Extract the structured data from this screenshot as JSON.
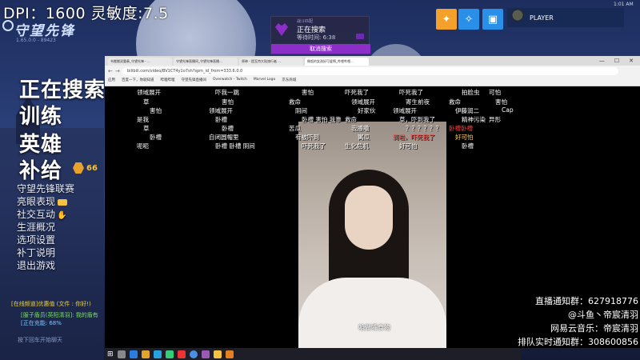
{
  "overlay": {
    "dpi_text": "DPI：1600 灵敏度:7.5",
    "clock": "1:01 AM"
  },
  "game": {
    "logo": "守望先锋",
    "version": "1.65.0.0 - 89423",
    "main_menu": [
      "正在搜索",
      "训练",
      "英雄",
      "补给"
    ],
    "level": "66",
    "sub_menu": [
      "守望先锋联赛",
      "亮眼表现",
      "社交互动",
      "生涯概况",
      "选项设置",
      "补丁说明",
      "退出游戏"
    ],
    "chat": [
      "[在线频道]优惠值 (文件 : 你好!)",
      "[服子盾员(英阳清羽]: 我的盾有",
      "[正在充能: 68%"
    ],
    "footnote": "按下回车开始聊天",
    "player_name": "PLAYER"
  },
  "search_popup": {
    "small": "战斗匹配",
    "title": "正在搜索",
    "wait": "等待时间: 6:38",
    "cancel": "取消搜索"
  },
  "browser": {
    "tabs": [
      "韦搬搬双重奏_守望先锋 - ...",
      "守望先锋直播间_守望先锋直播...",
      "原神 - 提瓦特大陆旅行者 ...",
      "做饭的女孩好可爱啊_哔哩哔哩..."
    ],
    "url": "bilibili.com/video/BV1CT4y1o7sh?spm_id_from=333.6.0.0",
    "bookmarks": [
      "应用",
      "百度一下，你就知道",
      "哔哩哔哩",
      "守望先锋直播间",
      "Overwatch - Twitch",
      "Marvel Logo",
      "京东商城"
    ]
  },
  "danmaku": [
    {
      "t": "领域展开",
      "c": "white"
    },
    {
      "t": "草",
      "c": "white"
    },
    {
      "t": "害怕",
      "c": "white"
    },
    {
      "t": "是我",
      "c": "white"
    },
    {
      "t": "草",
      "c": "white"
    },
    {
      "t": "卧槽",
      "c": "white"
    },
    {
      "t": "呃呃",
      "c": "white"
    },
    {
      "t": "吓我一跳",
      "c": "white"
    },
    {
      "t": "害怕",
      "c": "white"
    },
    {
      "t": "领域展开",
      "c": "white"
    },
    {
      "t": "卧槽",
      "c": "white"
    },
    {
      "t": "卧槽",
      "c": "white"
    },
    {
      "t": "自闭圆帽里",
      "c": "white"
    },
    {
      "t": "卧槽 卧槽 阴间",
      "c": "white"
    },
    {
      "t": "害怕",
      "c": "white"
    },
    {
      "t": "救命",
      "c": "white"
    },
    {
      "t": "阴间",
      "c": "white"
    },
    {
      "t": "卧槽 害怕 我靠",
      "c": "white"
    },
    {
      "t": "苦瓜",
      "c": "white"
    },
    {
      "t": "有被吓到",
      "c": "white"
    },
    {
      "t": "吓死我了",
      "c": "white"
    },
    {
      "t": "吓死我了",
      "c": "white"
    },
    {
      "t": "领域展开",
      "c": "white"
    },
    {
      "t": "好家伙",
      "c": "white"
    },
    {
      "t": "救命",
      "c": "white"
    },
    {
      "t": "我擦嘞",
      "c": "white"
    },
    {
      "t": "寓瓜",
      "c": "white"
    },
    {
      "t": "生化危机",
      "c": "white"
    },
    {
      "t": "吓死我了",
      "c": "white"
    },
    {
      "t": "寄生前夜",
      "c": "white"
    },
    {
      "t": "领域展开",
      "c": "white"
    },
    {
      "t": "草，吓到我了",
      "c": "white"
    },
    {
      "t": "？？？？？？",
      "c": "white"
    },
    {
      "t": "润啦，吓死我了",
      "c": "red"
    },
    {
      "t": "好可怕",
      "c": "white"
    },
    {
      "t": "拍脸虫",
      "c": "white"
    },
    {
      "t": "救命",
      "c": "white"
    },
    {
      "t": "伊藤润二",
      "c": "white"
    },
    {
      "t": "精神污染",
      "c": "white"
    },
    {
      "t": "卧槽卧槽",
      "c": "red"
    },
    {
      "t": "好可怕",
      "c": "yellow"
    },
    {
      "t": "卧槽",
      "c": "white"
    },
    {
      "t": "可怕",
      "c": "white"
    },
    {
      "t": "害怕",
      "c": "white"
    },
    {
      "t": "Cap",
      "c": "white"
    },
    {
      "t": "异形",
      "c": "white"
    }
  ],
  "video": {
    "subtitle": "咱做嘴食物",
    "watermark": "bilibili"
  },
  "notices": [
    "直播通知群：627918776",
    "@斗鱼丶帝宸清羽",
    "网易云音乐：帝宸清羽",
    "排队实时通知群：308600856"
  ],
  "colors": {
    "accent_purple": "#8e2ec9",
    "danmaku_red": "#ff4040",
    "gold": "#f5c242"
  }
}
